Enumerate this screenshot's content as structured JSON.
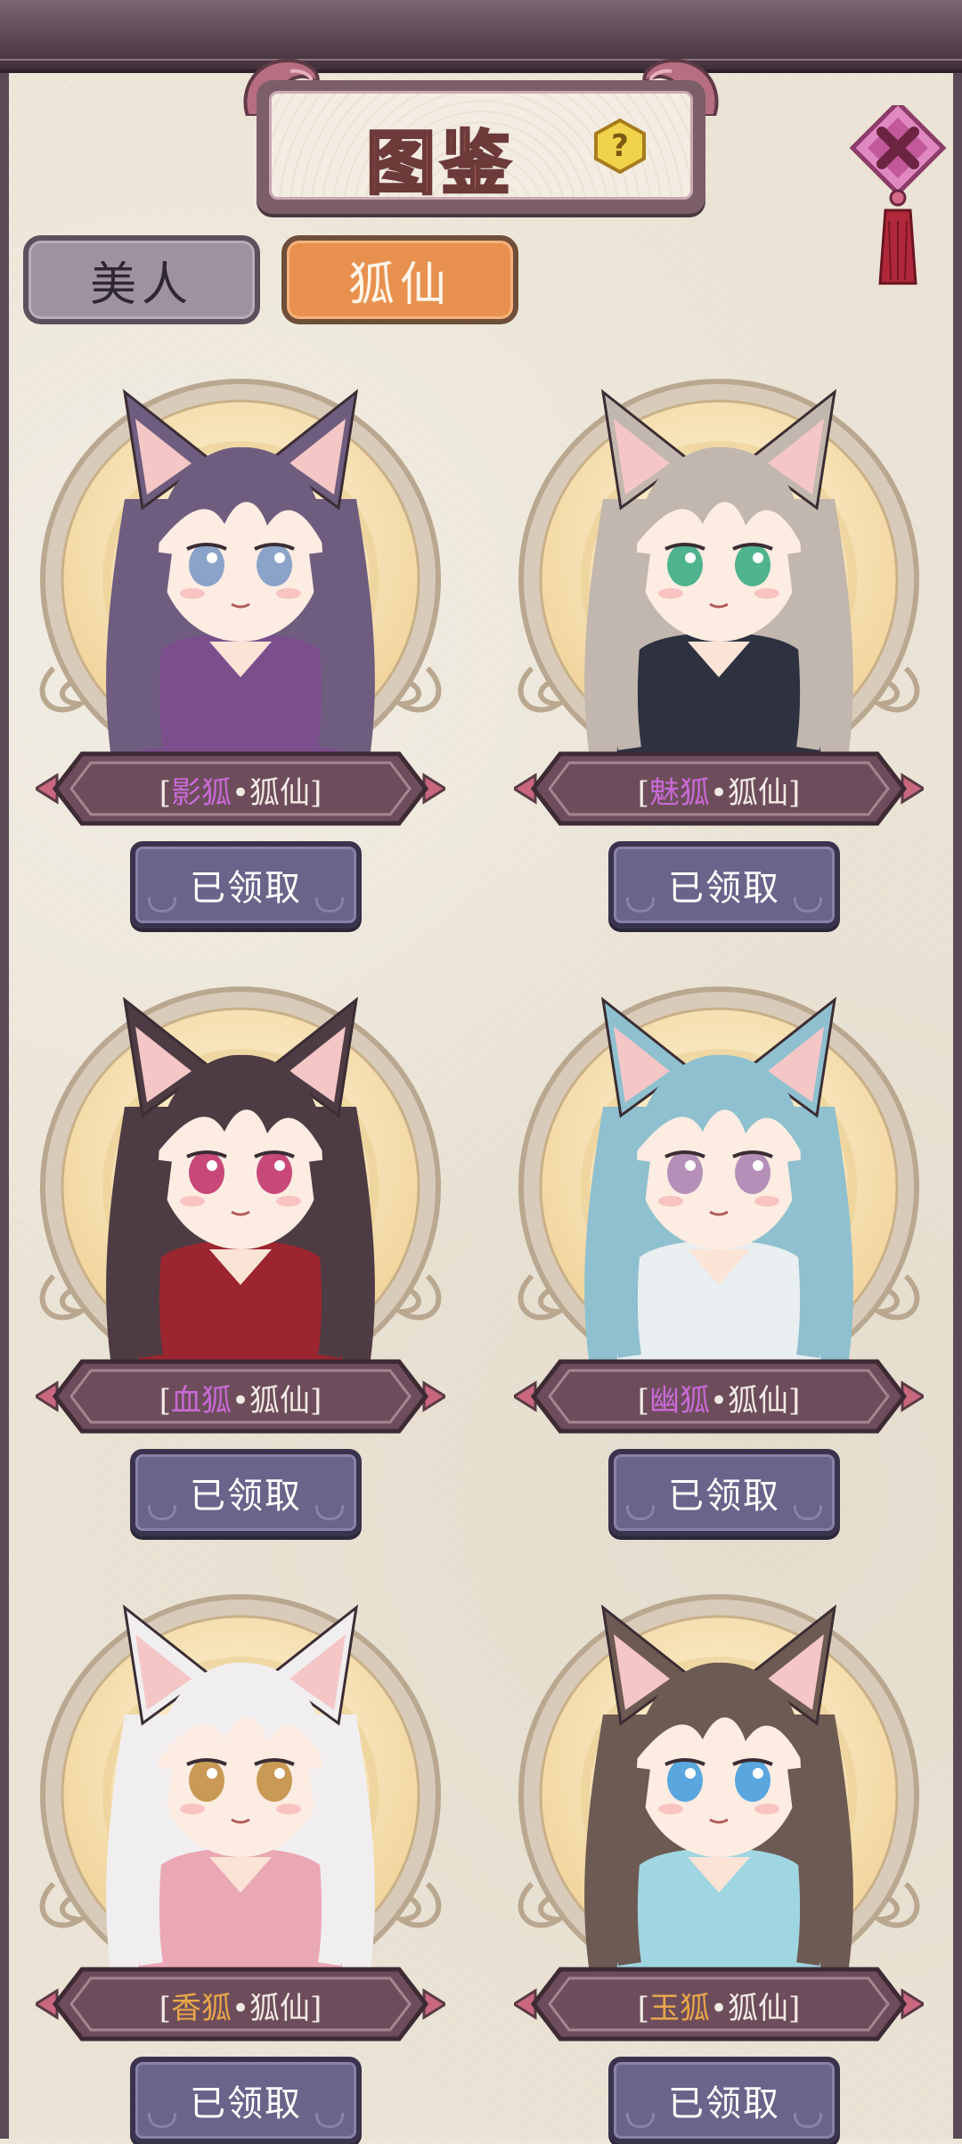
{
  "title": "图鉴",
  "help_symbol": "?",
  "tabs": [
    {
      "label": "美人",
      "active": false
    },
    {
      "label": "狐仙",
      "active": true
    }
  ],
  "cards": [
    {
      "accent": "影狐",
      "suffix": "•狐仙",
      "accent_color": "#c96ad6",
      "button": "已领取",
      "hair": "#6e5d7e",
      "outfit": "#7a4f8c",
      "eye": "#8aa3c8"
    },
    {
      "accent": "魅狐",
      "suffix": "•狐仙",
      "accent_color": "#c96ad6",
      "button": "已领取",
      "hair": "#c2b7ae",
      "outfit": "#2d3140",
      "eye": "#4fb38e"
    },
    {
      "accent": "血狐",
      "suffix": "•狐仙",
      "accent_color": "#c96ad6",
      "button": "已领取",
      "hair": "#4e3c44",
      "outfit": "#9b2630",
      "eye": "#c8487a"
    },
    {
      "accent": "幽狐",
      "suffix": "•狐仙",
      "accent_color": "#c96ad6",
      "button": "已领取",
      "hair": "#8fc0cf",
      "outfit": "#e9eef0",
      "eye": "#b48fb8"
    },
    {
      "accent": "香狐",
      "suffix": "•狐仙",
      "accent_color": "#e9a64a",
      "button": "已领取",
      "hair": "#f1eef0",
      "outfit": "#eaa7b4",
      "eye": "#c99a55"
    },
    {
      "accent": "玉狐",
      "suffix": "•狐仙",
      "accent_color": "#e9a64a",
      "button": "已领取",
      "hair": "#6d5a52",
      "outfit": "#9fd6e2",
      "eye": "#5aa6de"
    }
  ]
}
